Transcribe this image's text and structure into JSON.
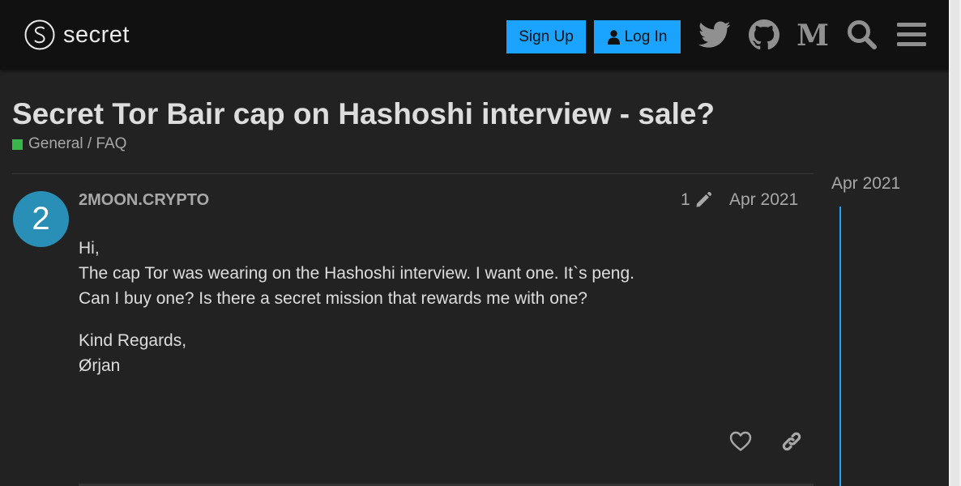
{
  "header": {
    "logo_text": "secret",
    "signup_label": "Sign Up",
    "login_label": "Log In",
    "icons": [
      "twitter-icon",
      "github-icon",
      "medium-icon",
      "search-icon",
      "hamburger-menu-icon"
    ]
  },
  "topic": {
    "title": "Secret Tor Bair cap on Hashoshi interview - sale?",
    "category": "General / FAQ",
    "category_color": "#3ab54a"
  },
  "post": {
    "avatar_letter": "2",
    "avatar_color": "#2a8fb6",
    "username": "2MOON.CRYPTO",
    "edit_count": "1",
    "date": "Apr 2021",
    "paragraph1_lines": [
      "Hi,",
      "The cap Tor was wearing on the Hashoshi interview. I want one. It`s peng.",
      "Can I buy one? Is there a secret mission that rewards me with one?"
    ],
    "paragraph2_lines": [
      "Kind Regards,",
      "Ørjan"
    ]
  },
  "timeline": {
    "date": "Apr 2021"
  },
  "colors": {
    "accent": "#1aa3ff",
    "background": "#222222",
    "header_bg": "#111111"
  }
}
